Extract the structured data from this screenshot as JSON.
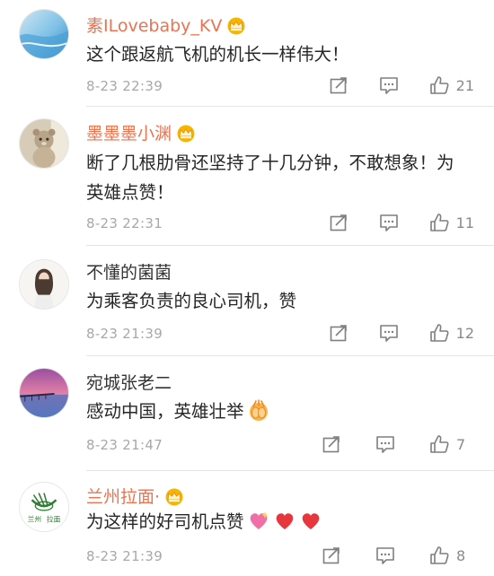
{
  "comments": [
    {
      "username": "素ILovebaby_KV",
      "text": "这个跟返航飞机的机长一样伟大！",
      "time": "8-23 22:39",
      "likes": "21",
      "vip": true,
      "avatar_icon": "ocean-wave-avatar"
    },
    {
      "username": "墨墨墨小渊",
      "text": "断了几根肋骨还坚持了十几分钟，不敢想象！为英雄点赞！",
      "time": "8-23 22:31",
      "likes": "11",
      "vip": true,
      "avatar_icon": "bear-toy-avatar"
    },
    {
      "username": "不懂的菌菌",
      "text": "为乘客负责的良心司机，赞",
      "time": "8-23 21:39",
      "likes": "12",
      "vip": false,
      "avatar_icon": "girl-illustration-avatar"
    },
    {
      "username": "宛城张老二",
      "text": "感动中国，英雄壮举",
      "time": "8-23 21:47",
      "likes": "7",
      "vip": false,
      "avatar_icon": "pier-sunset-avatar",
      "emoji": "clapping-hands-emoji"
    },
    {
      "username": "兰州拉面·",
      "text": "为这样的好司机点赞",
      "time": "8-23 21:39",
      "likes": "8",
      "vip": true,
      "avatar_icon": "noodle-logo-avatar",
      "avatar_text": [
        "兰州",
        "拉面"
      ],
      "emoji": [
        "sparkling-heart-emoji",
        "red-heart-emoji",
        "red-heart-emoji"
      ]
    }
  ],
  "colors": {
    "username_vip": "#eb7350",
    "username_normal": "#333333",
    "meta": "#a8a8a8",
    "divider": "#e5e5e5",
    "heart": "#e8373c"
  },
  "icons": {
    "repost": "repost-icon",
    "comment": "comment-icon",
    "like": "thumbs-up-icon",
    "vip": "crown-icon"
  }
}
